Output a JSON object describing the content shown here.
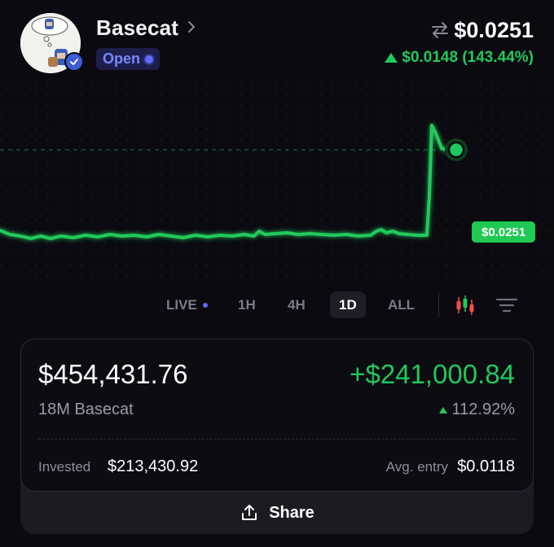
{
  "token": {
    "name": "Basecat",
    "status": "Open",
    "price": "$0.0251",
    "change": "$0.0148 (143.44%)"
  },
  "chart": {
    "price_tag": "$0.0251",
    "line_color": "#20c95b"
  },
  "timeframes": [
    {
      "label": "LIVE",
      "active": false
    },
    {
      "label": "1H",
      "active": false
    },
    {
      "label": "4H",
      "active": false
    },
    {
      "label": "1D",
      "active": true
    },
    {
      "label": "ALL",
      "active": false
    }
  ],
  "position": {
    "value": "$454,431.76",
    "pnl": "+$241,000.84",
    "quantity": "18M Basecat",
    "pnl_percent": "112.92%",
    "invested_label": "Invested",
    "invested_value": "$213,430.92",
    "avg_entry_label": "Avg. entry",
    "avg_entry_value": "$0.0118"
  },
  "share": {
    "label": "Share"
  },
  "colors": {
    "accent_green": "#20c95b",
    "accent_blue": "#5e6cff",
    "background": "#0b0a10"
  },
  "icons": {
    "avatar": "cat-mascot-avatar",
    "verified": "verified-badge-icon",
    "chevron": "chevron-right-icon",
    "swap": "swap-arrows-icon",
    "candles": "candlestick-chart-icon",
    "filter": "filter-lines-icon",
    "share": "share-upload-icon"
  }
}
